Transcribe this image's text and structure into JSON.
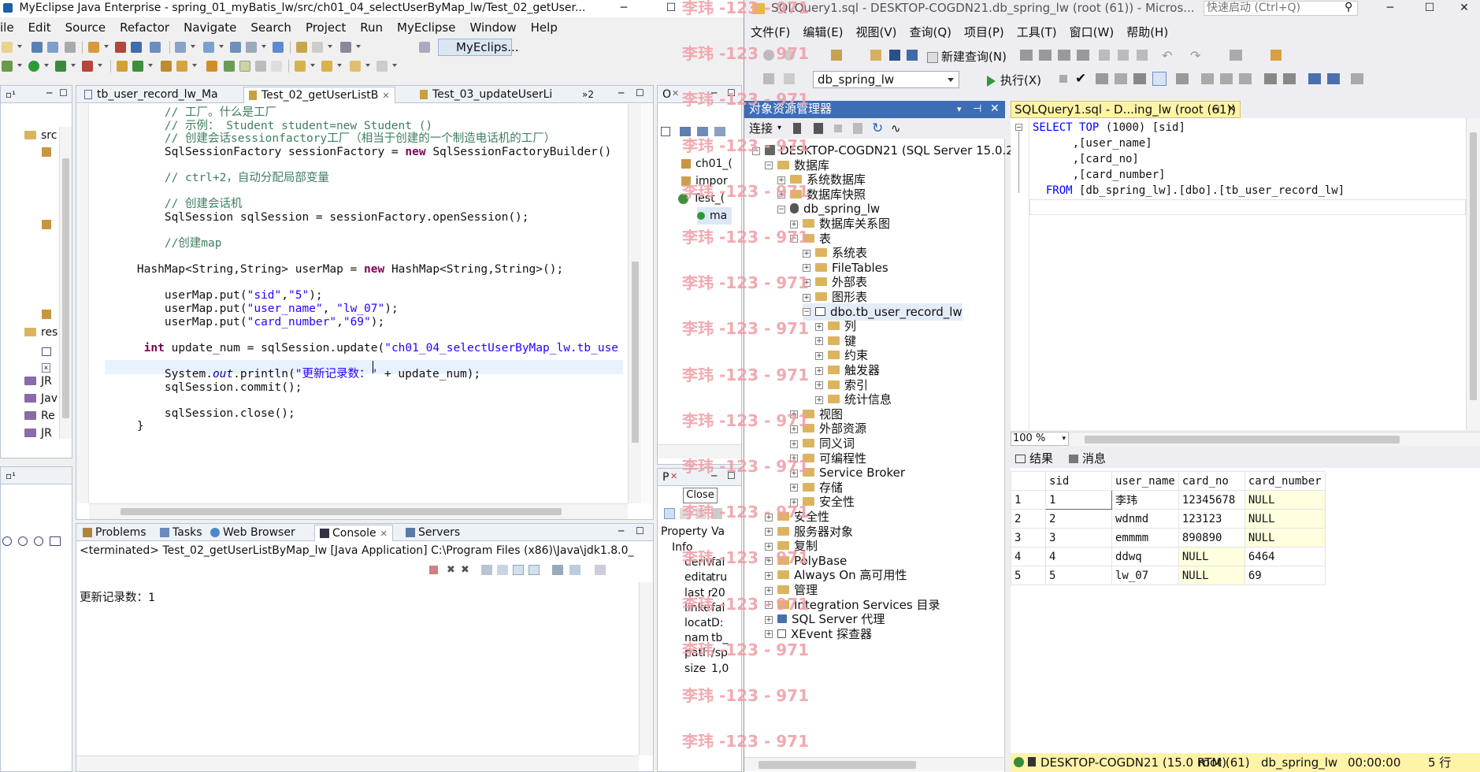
{
  "eclipse": {
    "title": "MyEclipse Java Enterprise - spring_01_myBatis_lw/src/ch01_04_selectUserByMap_lw/Test_02_getUser...",
    "menu": [
      "ile",
      "Edit",
      "Source",
      "Refactor",
      "Navigate",
      "Search",
      "Project",
      "Run",
      "MyEclipse",
      "Window",
      "Help"
    ],
    "perspective": "MyEclips...",
    "editor_tabs": [
      "tb_user_record_lw_Ma",
      "Test_02_getUserListB",
      "Test_03_updateUserLi",
      "»2"
    ],
    "left_tree": [
      "src",
      "res",
      "JR",
      "Jav",
      "Re",
      "JR"
    ],
    "code_lines": [
      {
        "indent": "        ",
        "parts": [
          {
            "c": "cm",
            "t": "// 工厂。什么是工厂"
          }
        ]
      },
      {
        "indent": "        ",
        "parts": [
          {
            "c": "cm",
            "t": "// 示例： Student student=new Student ()"
          }
        ]
      },
      {
        "indent": "        ",
        "parts": [
          {
            "c": "cm",
            "t": "// 创建会话sessionfactory工厂（相当于创建的一个制造电话机的工厂）"
          }
        ]
      },
      {
        "indent": "        ",
        "parts": [
          {
            "c": "",
            "t": "SqlSessionFactory sessionFactory = "
          },
          {
            "c": "kw",
            "t": "new"
          },
          {
            "c": "",
            "t": " SqlSessionFactoryBuilder()"
          }
        ]
      },
      {
        "indent": "",
        "parts": []
      },
      {
        "indent": "        ",
        "parts": [
          {
            "c": "cm",
            "t": "// ctrl+2，自动分配局部变量"
          }
        ]
      },
      {
        "indent": "",
        "parts": []
      },
      {
        "indent": "        ",
        "parts": [
          {
            "c": "cm",
            "t": "// 创建会话机"
          }
        ]
      },
      {
        "indent": "        ",
        "parts": [
          {
            "c": "",
            "t": "SqlSession sqlSession = sessionFactory.openSession();"
          }
        ]
      },
      {
        "indent": "",
        "parts": []
      },
      {
        "indent": "        ",
        "parts": [
          {
            "c": "cm",
            "t": "//创建map"
          }
        ]
      },
      {
        "indent": "",
        "parts": []
      },
      {
        "indent": "    ",
        "parts": [
          {
            "c": "",
            "t": "HashMap<String,String> userMap = "
          },
          {
            "c": "kw",
            "t": "new"
          },
          {
            "c": "",
            "t": " HashMap<String,String>();"
          }
        ]
      },
      {
        "indent": "",
        "parts": []
      },
      {
        "indent": "        ",
        "parts": [
          {
            "c": "",
            "t": "userMap.put("
          },
          {
            "c": "st",
            "t": "\"sid\""
          },
          {
            "c": "",
            "t": ","
          },
          {
            "c": "st",
            "t": "\"5\""
          },
          {
            "c": "",
            "t": ");"
          }
        ]
      },
      {
        "indent": "        ",
        "parts": [
          {
            "c": "",
            "t": "userMap.put("
          },
          {
            "c": "st",
            "t": "\"user_name\""
          },
          {
            "c": "",
            "t": ", "
          },
          {
            "c": "st",
            "t": "\"lw_07\""
          },
          {
            "c": "",
            "t": ");"
          }
        ]
      },
      {
        "indent": "        ",
        "parts": [
          {
            "c": "",
            "t": "userMap.put("
          },
          {
            "c": "st",
            "t": "\"card_number\""
          },
          {
            "c": "",
            "t": ","
          },
          {
            "c": "st",
            "t": "\"69\""
          },
          {
            "c": "",
            "t": ");"
          }
        ]
      },
      {
        "indent": "",
        "parts": []
      },
      {
        "indent": "     ",
        "parts": [
          {
            "c": "kw",
            "t": "int"
          },
          {
            "c": "",
            "t": " update_num = sqlSession.update("
          },
          {
            "c": "st",
            "t": "\"ch01_04_selectUserByMap_lw.tb_use"
          }
        ]
      },
      {
        "indent": "",
        "parts": []
      },
      {
        "indent": "        ",
        "parts": [
          {
            "c": "",
            "t": "System."
          },
          {
            "c": "it",
            "t": "out"
          },
          {
            "c": "",
            "t": ".println("
          },
          {
            "c": "st",
            "t": "\"更新记录数：\""
          },
          {
            "c": "",
            "t": " + update_num);"
          }
        ]
      },
      {
        "indent": "        ",
        "parts": [
          {
            "c": "",
            "t": "sqlSession.commit();"
          }
        ]
      },
      {
        "indent": "",
        "parts": []
      },
      {
        "indent": "        ",
        "parts": [
          {
            "c": "",
            "t": "sqlSession.close();"
          }
        ]
      },
      {
        "indent": "    ",
        "parts": [
          {
            "c": "",
            "t": "}"
          }
        ]
      }
    ],
    "outline": [
      "ch01_(",
      "impor",
      "Test_(",
      "ma"
    ],
    "bottom_tabs": [
      "Problems",
      "Tasks",
      "Web Browser",
      "Console",
      "Servers"
    ],
    "console_status": "<terminated> Test_02_getUserListByMap_lw [Java Application] C:\\Program Files (x86)\\Java\\jdk1.8.0_",
    "console_output": "更新记录数：1",
    "props": {
      "tab": "P",
      "close_tooltip": "Close",
      "header": [
        "Property",
        "Va"
      ],
      "rows": [
        [
          "Info",
          ""
        ],
        [
          "deriv",
          "fal"
        ],
        [
          "edita",
          "tru"
        ],
        [
          "last r",
          "20"
        ],
        [
          "linke",
          "fal"
        ],
        [
          "locat",
          "D:"
        ],
        [
          "nam",
          "tb_"
        ],
        [
          "path",
          "/sp"
        ],
        [
          "size",
          "1,0"
        ]
      ]
    }
  },
  "ssms": {
    "title": "SQLQuery1.sql - DESKTOP-COGDN21.db_spring_lw (root (61)) - Micros...",
    "quick_launch": "快速启动 (Ctrl+Q)",
    "menu": [
      "文件(F)",
      "编辑(E)",
      "视图(V)",
      "查询(Q)",
      "项目(P)",
      "工具(T)",
      "窗口(W)",
      "帮助(H)"
    ],
    "new_query": "新建查询(N)",
    "database": "db_spring_lw",
    "execute": "执行(X)",
    "oe_title": "对象资源管理器",
    "connect": "连接",
    "tree": [
      {
        "level": 0,
        "exp": "-",
        "icon": "server",
        "label": "DESKTOP-COGDN21 (SQL Server 15.0.2"
      },
      {
        "level": 1,
        "exp": "-",
        "icon": "folder",
        "label": "数据库"
      },
      {
        "level": 2,
        "exp": "+",
        "icon": "folder",
        "label": "系统数据库"
      },
      {
        "level": 2,
        "exp": "+",
        "icon": "folder",
        "label": "数据库快照"
      },
      {
        "level": 2,
        "exp": "-",
        "icon": "db",
        "label": "db_spring_lw"
      },
      {
        "level": 3,
        "exp": "+",
        "icon": "folder",
        "label": "数据库关系图"
      },
      {
        "level": 3,
        "exp": "-",
        "icon": "folder",
        "label": "表"
      },
      {
        "level": 4,
        "exp": "+",
        "icon": "folder",
        "label": "系统表"
      },
      {
        "level": 4,
        "exp": "+",
        "icon": "folder",
        "label": "FileTables"
      },
      {
        "level": 4,
        "exp": "+",
        "icon": "folder",
        "label": "外部表"
      },
      {
        "level": 4,
        "exp": "+",
        "icon": "folder",
        "label": "图形表"
      },
      {
        "level": 4,
        "exp": "-",
        "icon": "table",
        "label": "dbo.tb_user_record_lw"
      },
      {
        "level": 5,
        "exp": "+",
        "icon": "folder",
        "label": "列"
      },
      {
        "level": 5,
        "exp": "+",
        "icon": "folder",
        "label": "键"
      },
      {
        "level": 5,
        "exp": "+",
        "icon": "folder",
        "label": "约束"
      },
      {
        "level": 5,
        "exp": "+",
        "icon": "folder",
        "label": "触发器"
      },
      {
        "level": 5,
        "exp": "+",
        "icon": "folder",
        "label": "索引"
      },
      {
        "level": 5,
        "exp": "+",
        "icon": "folder",
        "label": "统计信息"
      },
      {
        "level": 3,
        "exp": "+",
        "icon": "folder",
        "label": "视图"
      },
      {
        "level": 3,
        "exp": "+",
        "icon": "folder",
        "label": "外部资源"
      },
      {
        "level": 3,
        "exp": "+",
        "icon": "folder",
        "label": "同义词"
      },
      {
        "level": 3,
        "exp": "+",
        "icon": "folder",
        "label": "可编程性"
      },
      {
        "level": 3,
        "exp": "+",
        "icon": "folder",
        "label": "Service Broker"
      },
      {
        "level": 3,
        "exp": "+",
        "icon": "folder",
        "label": "存储"
      },
      {
        "level": 3,
        "exp": "+",
        "icon": "folder",
        "label": "安全性"
      },
      {
        "level": 1,
        "exp": "+",
        "icon": "folder",
        "label": "安全性"
      },
      {
        "level": 1,
        "exp": "+",
        "icon": "folder",
        "label": "服务器对象"
      },
      {
        "level": 1,
        "exp": "+",
        "icon": "folder",
        "label": "复制"
      },
      {
        "level": 1,
        "exp": "+",
        "icon": "folder",
        "label": "PolyBase"
      },
      {
        "level": 1,
        "exp": "+",
        "icon": "folder",
        "label": "Always On 高可用性"
      },
      {
        "level": 1,
        "exp": "+",
        "icon": "folder",
        "label": "管理"
      },
      {
        "level": 1,
        "exp": "+",
        "icon": "folder",
        "label": "Integration Services 目录"
      },
      {
        "level": 1,
        "exp": "+",
        "icon": "agent",
        "label": "SQL Server 代理"
      },
      {
        "level": 1,
        "exp": "+",
        "icon": "xevent",
        "label": "XEvent 探查器"
      }
    ],
    "query_tab": "SQLQuery1.sql - D...ing_lw (root (61))",
    "sql_lines": [
      [
        {
          "c": "sk",
          "t": "SELECT"
        },
        {
          "c": "",
          "t": " "
        },
        {
          "c": "sk",
          "t": "TOP"
        },
        {
          "c": "",
          "t": " (1000) [sid]"
        }
      ],
      [
        {
          "c": "",
          "t": "      ,[user_name]"
        }
      ],
      [
        {
          "c": "",
          "t": "      ,[card_no]"
        }
      ],
      [
        {
          "c": "",
          "t": "      ,[card_number]"
        }
      ],
      [
        {
          "c": "sk",
          "t": "  FROM"
        },
        {
          "c": "",
          "t": " [db_spring_lw].[dbo].[tb_user_record_lw]"
        }
      ]
    ],
    "zoom": "100 %",
    "result_tabs": [
      "结果",
      "消息"
    ],
    "columns": [
      "sid",
      "user_name",
      "card_no",
      "card_number"
    ],
    "rows": [
      [
        "1",
        "1",
        "李玮",
        "12345678",
        "NULL"
      ],
      [
        "2",
        "2",
        "wdnmd",
        "123123",
        "NULL"
      ],
      [
        "3",
        "3",
        "emmmm",
        "890890",
        "NULL"
      ],
      [
        "4",
        "4",
        "ddwq",
        "NULL",
        "6464"
      ],
      [
        "5",
        "5",
        "lw_07",
        "NULL",
        "69"
      ]
    ],
    "status": {
      "server": "DESKTOP-COGDN21 (15.0 RTM)",
      "user": "root (61)",
      "db": "db_spring_lw",
      "time": "00:00:00",
      "rows": "5 行"
    }
  },
  "watermark": "李玮 -123 - 971"
}
